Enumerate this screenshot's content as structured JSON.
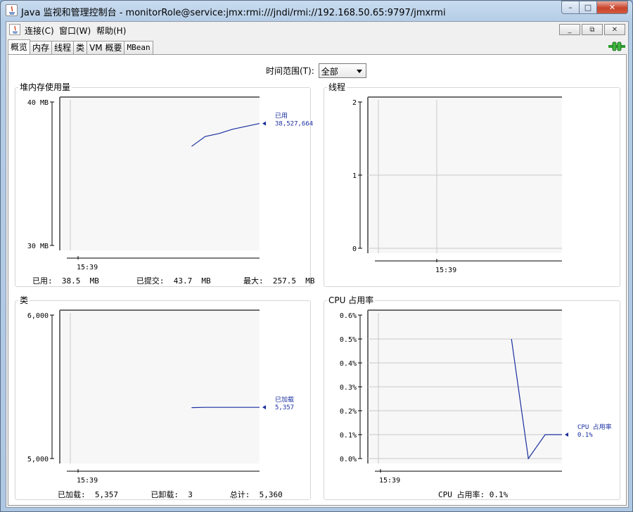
{
  "window": {
    "title": "Java 监视和管理控制台 - monitorRole@service:jmx:rmi:///jndi/rmi://192.168.50.65:9797/jmxrmi",
    "minimize": "–",
    "maximize": "□",
    "close": "✕"
  },
  "menu": {
    "items": [
      "连接(C)",
      "窗口(W)",
      "帮助(H)"
    ],
    "mdi_buttons": [
      "_",
      "⧉",
      "✕"
    ]
  },
  "tabs": [
    {
      "label": "概览",
      "active": true
    },
    {
      "label": "内存",
      "active": false
    },
    {
      "label": "线程",
      "active": false
    },
    {
      "label": "类",
      "active": false
    },
    {
      "label": "VM 概要",
      "active": false
    },
    {
      "label": "MBean",
      "active": false
    }
  ],
  "time_range": {
    "label": "时间范围(T):",
    "value": "全部"
  },
  "panels": {
    "heap": {
      "title": "堆内存使用量",
      "stats": "已用:  38.5  MB        已提交:  43.7  MB       最大:  257.5  MB",
      "current_label": "已用",
      "current_value": "38,527,664"
    },
    "threads": {
      "title": "线程"
    },
    "classes": {
      "title": "类",
      "stats": "已加载:  5,357       已卸载:  3        总计:  5,360",
      "current_label": "已加载",
      "current_value": "5,357"
    },
    "cpu": {
      "title": "CPU 占用率",
      "stats": "CPU 占用率: 0.1%",
      "current_label": "CPU 占用率",
      "current_value": "0.1%"
    }
  },
  "colors": {
    "series": "#1a2fa0",
    "plot_bg": "#f7f7f7",
    "grid": "#c8c8c8",
    "connected": "#2e9b2e"
  },
  "chart_data": [
    {
      "type": "line",
      "title": "堆内存使用量",
      "ylabel": "",
      "y_ticks": [
        "40 MB",
        "30 MB"
      ],
      "ylim": [
        30,
        40
      ],
      "x_ticks": [
        "15:39"
      ],
      "series": [
        {
          "name": "已用",
          "values": [
            36.9,
            37.6,
            37.8,
            38.1,
            38.3,
            38.5
          ]
        }
      ]
    },
    {
      "type": "line",
      "title": "线程",
      "y_ticks": [
        "2",
        "1",
        "0"
      ],
      "ylim": [
        0,
        2
      ],
      "x_ticks": [
        "15:39"
      ],
      "series": []
    },
    {
      "type": "line",
      "title": "类",
      "y_ticks": [
        "6,000",
        "5,000"
      ],
      "ylim": [
        5000,
        6000
      ],
      "x_ticks": [
        "15:39"
      ],
      "series": [
        {
          "name": "已加载",
          "values": [
            5355,
            5357,
            5357,
            5357,
            5357,
            5357
          ]
        }
      ]
    },
    {
      "type": "line",
      "title": "CPU 占用率",
      "y_ticks": [
        "0.6%",
        "0.5%",
        "0.4%",
        "0.3%",
        "0.2%",
        "0.1%",
        "0.0%"
      ],
      "ylim": [
        0,
        0.6
      ],
      "x_ticks": [
        "15:39"
      ],
      "series": [
        {
          "name": "CPU 占用率",
          "values": [
            0.5,
            0.0,
            0.1,
            0.1
          ]
        }
      ]
    }
  ]
}
